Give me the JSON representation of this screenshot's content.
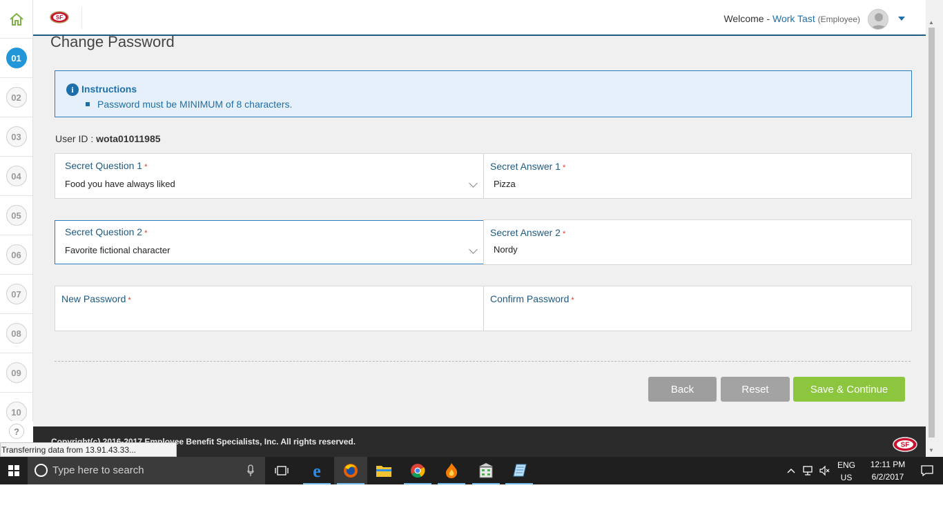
{
  "header": {
    "welcome_label": "Welcome -",
    "user_name": "Work Tast",
    "user_role": "(Employee)"
  },
  "steps": [
    "01",
    "02",
    "03",
    "04",
    "05",
    "06",
    "07",
    "08",
    "09",
    "10"
  ],
  "help_label": "?",
  "page": {
    "title": "Change Password",
    "instructions_title": "Instructions",
    "instructions_items": [
      "Password must be MINIMUM of 8 characters."
    ],
    "userid_label": "User ID :",
    "userid_value": "wota01011985"
  },
  "form": {
    "q1_label": "Secret Question 1",
    "q1_value": "Food you have always liked",
    "a1_label": "Secret Answer 1",
    "a1_value": "Pizza",
    "q2_label": "Secret Question 2",
    "q2_value": "Favorite fictional character",
    "a2_label": "Secret Answer 2",
    "a2_value": "Nordy",
    "new_password_label": "New Password",
    "confirm_password_label": "Confirm Password",
    "required_mark": "*"
  },
  "buttons": {
    "back": "Back",
    "reset": "Reset",
    "save": "Save & Continue"
  },
  "footer": {
    "copyright": "Copyright(c) 2016-2017 Employee Benefit Specialists, Inc. All rights reserved."
  },
  "browser_status": "Transferring data from 13.91.43.33...",
  "taskbar": {
    "search_placeholder": "Type here to search",
    "lang_top": "ENG",
    "lang_bottom": "US",
    "time": "12:11 PM",
    "date": "6/2/2017"
  },
  "colors": {
    "accent_blue": "#1e6fa8",
    "active_step": "#2196d9",
    "save_green": "#8cc63f",
    "header_rule": "#1e5a82"
  }
}
